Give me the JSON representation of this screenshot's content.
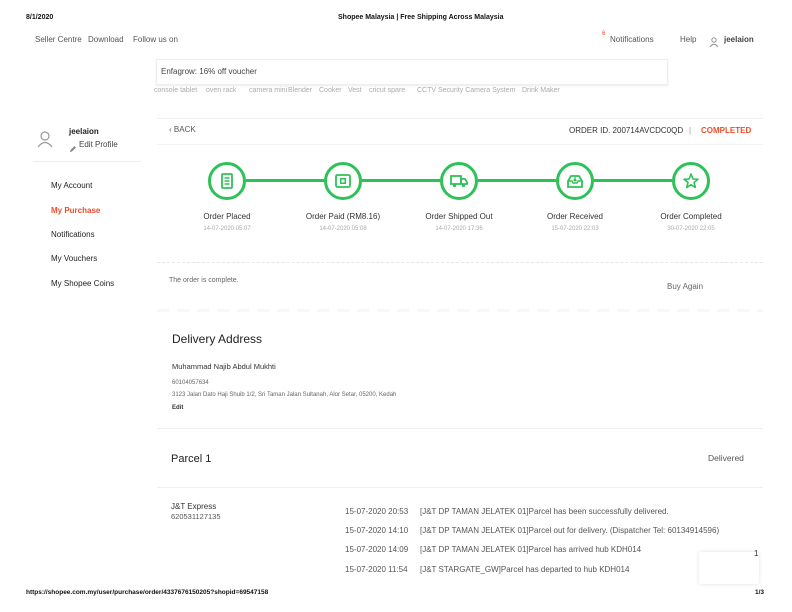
{
  "print_header": {
    "date": "8/1/2020",
    "title": "Shopee Malaysia | Free Shipping Across Malaysia",
    "url": "https://shopee.com.my/user/purchase/order/4337676150205?shopid=69547158",
    "page": "1/3"
  },
  "topbar": {
    "links": [
      "Seller Centre",
      "Download",
      "Follow us on"
    ],
    "notifications": "Notifications",
    "notification_badge": "6",
    "help": "Help",
    "username": "jeelaion"
  },
  "search": {
    "value": "Enfagrow: 16% off voucher",
    "suggestions": [
      "console tablet",
      "oven rack",
      "camera mini",
      "Blender",
      "Cooker",
      "Vest",
      "cricut spare",
      "CCTV Security Camera System",
      "Drink Maker"
    ]
  },
  "sidebar": {
    "username": "jeelaion",
    "edit_profile": "Edit Profile",
    "items": [
      "My Account",
      "My Purchase",
      "Notifications",
      "My Vouchers",
      "My Shopee Coins"
    ],
    "active_index": 1
  },
  "order": {
    "back": "BACK",
    "order_id": "ORDER ID. 200714AVCDC0QD",
    "separator": "|",
    "status": "COMPLETED",
    "steps": [
      {
        "label": "Order Placed",
        "time": "14-07-2020 05:07",
        "icon": "receipt-icon"
      },
      {
        "label": "Order Paid (RM8.16)",
        "time": "14-07-2020 05:08",
        "icon": "payment-icon"
      },
      {
        "label": "Order Shipped Out",
        "time": "14-07-2020 17:36",
        "icon": "truck-icon"
      },
      {
        "label": "Order Received",
        "time": "15-07-2020 22:03",
        "icon": "inbox-icon"
      },
      {
        "label": "Order Completed",
        "time": "30-07-2020 22:05",
        "icon": "star-icon"
      }
    ],
    "complete_message": "The order is complete.",
    "buy_again": "Buy Again"
  },
  "delivery": {
    "heading": "Delivery Address",
    "name": "Muhammad Najib Abdul Mukhti",
    "phone": "60104057634",
    "address": "3123 Jalan Dato Haji Shuib 1/2, Sri Taman Jalan Sultanah, Alor Setar, 05200, Kedah",
    "edit": "Edit"
  },
  "parcel": {
    "title": "Parcel 1",
    "status": "Delivered",
    "courier": "J&T Express",
    "tracking_no": "620531127135",
    "events": [
      {
        "time": "15-07-2020 20:53",
        "desc": "[J&T DP TAMAN JELATEK 01]Parcel has been successfully delivered."
      },
      {
        "time": "15-07-2020 14:10",
        "desc": "[J&T DP TAMAN JELATEK 01]Parcel out for delivery. (Dispatcher Tel: 60134914596)"
      },
      {
        "time": "15-07-2020 14:09",
        "desc": "[J&T DP TAMAN JELATEK 01]Parcel has arrived hub KDH014"
      },
      {
        "time": "15-07-2020 11:54",
        "desc": "[J&T STARGATE_GW]Parcel has departed to hub KDH014"
      }
    ]
  },
  "chat_badge": "1",
  "colors": {
    "accent": "#ee4d2d",
    "step_green": "#2dc258"
  }
}
